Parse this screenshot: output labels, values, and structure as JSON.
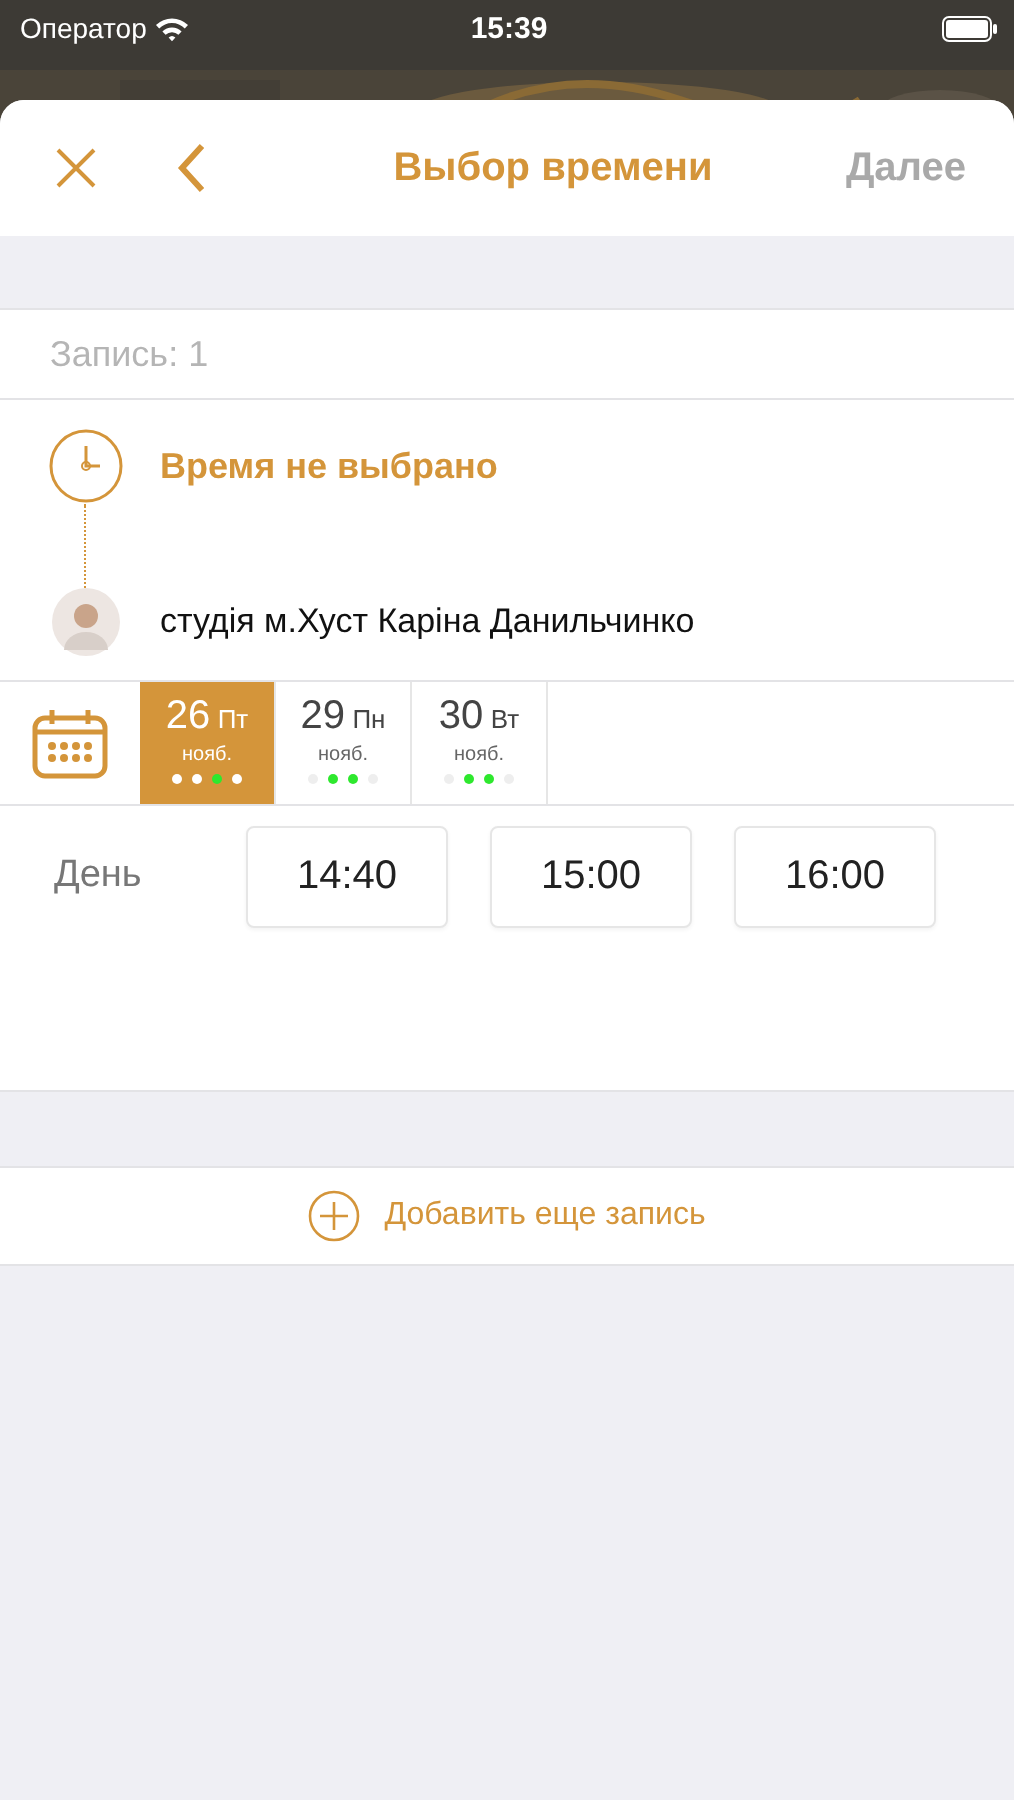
{
  "status_bar": {
    "carrier": "Оператор",
    "time": "15:39"
  },
  "header": {
    "title": "Выбор времени",
    "next": {
      "label": "Далее",
      "disabled": true
    }
  },
  "record": {
    "label": "Запись: 1"
  },
  "booking": {
    "time_status": "Время не выбрано",
    "master": "студія м.Хуст Каріна Данильчинко"
  },
  "dates": [
    {
      "day": "26",
      "weekday": "Пт",
      "month": "нояб.",
      "selected": true,
      "dots": [
        {
          "color": "#ffffff"
        },
        {
          "color": "#ffffff"
        },
        {
          "color": "#2ee82e"
        },
        {
          "color": "#ffffff"
        }
      ]
    },
    {
      "day": "29",
      "weekday": "Пн",
      "month": "нояб.",
      "selected": false,
      "dots": [
        {
          "color": "#eeeeee"
        },
        {
          "color": "#2ee82e"
        },
        {
          "color": "#2ee82e"
        },
        {
          "color": "#eeeeee"
        }
      ]
    },
    {
      "day": "30",
      "weekday": "Вт",
      "month": "нояб.",
      "selected": false,
      "dots": [
        {
          "color": "#eeeeee"
        },
        {
          "color": "#2ee82e"
        },
        {
          "color": "#2ee82e"
        },
        {
          "color": "#eeeeee"
        }
      ]
    }
  ],
  "slots": {
    "period": "День",
    "times": [
      "14:40",
      "15:00",
      "16:00"
    ]
  },
  "add_button": {
    "label": "Добавить еще запись"
  }
}
